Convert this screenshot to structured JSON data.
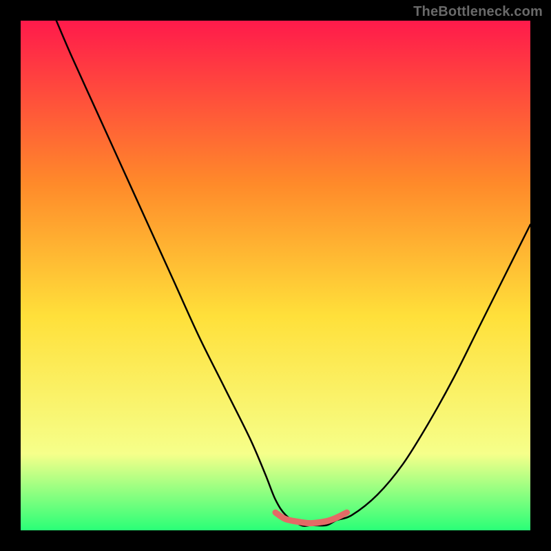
{
  "watermark": "TheBottleneck.com",
  "colors": {
    "frame": "#000000",
    "grad_top": "#ff1a4b",
    "grad_mid1": "#ff8a2a",
    "grad_mid2": "#ffe03a",
    "grad_mid3": "#f6ff8a",
    "grad_bottom": "#2aff77",
    "curve": "#000000",
    "highlight": "#e36a66"
  },
  "chart_data": {
    "type": "line",
    "title": "",
    "xlabel": "",
    "ylabel": "",
    "xlim": [
      0,
      100
    ],
    "ylim": [
      0,
      100
    ],
    "grid": false,
    "legend": false,
    "series": [
      {
        "name": "bottleneck-curve",
        "x": [
          7,
          10,
          15,
          20,
          25,
          30,
          35,
          40,
          45,
          48,
          50,
          52,
          55,
          57,
          60,
          62,
          65,
          70,
          75,
          80,
          85,
          90,
          95,
          100
        ],
        "y": [
          100,
          93,
          82,
          71,
          60,
          49,
          38,
          28,
          18,
          11,
          6,
          3,
          1,
          1,
          1,
          2,
          3,
          7,
          13,
          21,
          30,
          40,
          50,
          60
        ]
      },
      {
        "name": "optimal-range-highlight",
        "x": [
          50,
          52,
          55,
          57,
          60,
          62,
          64
        ],
        "y": [
          3.5,
          2.2,
          1.6,
          1.4,
          1.8,
          2.5,
          3.5
        ]
      }
    ],
    "annotations": []
  }
}
